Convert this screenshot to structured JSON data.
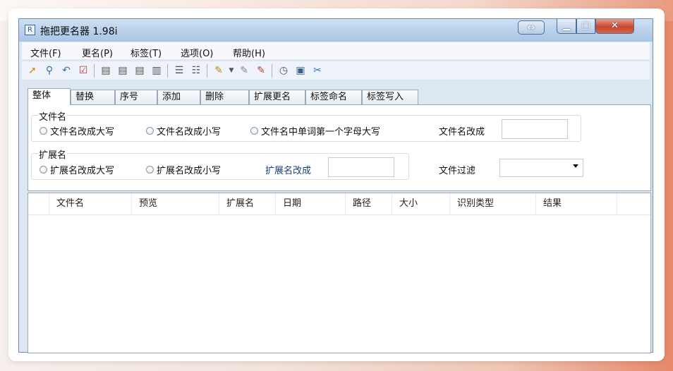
{
  "window": {
    "title": "拖把更名器 1.98i"
  },
  "menu": [
    "文件(F)",
    "更名(P)",
    "标签(T)",
    "选项(O)",
    "帮助(H)"
  ],
  "toolbar_icons": [
    "open-folder-icon",
    "search-icon",
    "undo-icon",
    "check-icon",
    "tag-doc-icon",
    "tag-doc-icon",
    "tag-doc-icon",
    "tag-doc-icon",
    "list-icon",
    "list-icon",
    "pen-icon",
    "dropdown-icon",
    "pen-icon",
    "pen-delete-icon",
    "clock-icon",
    "window-icon",
    "tools-icon"
  ],
  "tabs": [
    "整体",
    "替换",
    "序号",
    "添加",
    "删除",
    "扩展更名",
    "标签命名",
    "标签写入"
  ],
  "filename_group": {
    "label": "文件名",
    "options": [
      "文件名改成大写",
      "文件名改成小写",
      "文件名中单词第一个字母大写"
    ],
    "rename_label": "文件名改成",
    "rename_value": ""
  },
  "ext_group": {
    "label": "扩展名",
    "options": [
      "扩展名改成大写",
      "扩展名改成小写"
    ],
    "rename_label": "扩展名改成",
    "rename_value": ""
  },
  "filter": {
    "label": "文件过滤",
    "value": ""
  },
  "columns": [
    "文件名",
    "预览",
    "扩展名",
    "日期",
    "路径",
    "大小",
    "识别类型",
    "结果"
  ]
}
